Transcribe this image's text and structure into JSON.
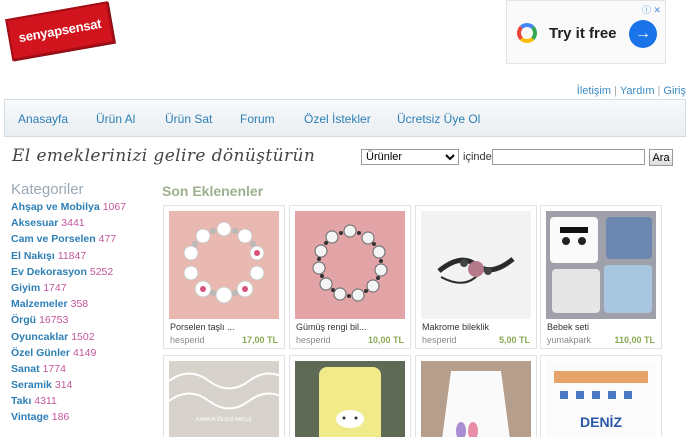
{
  "logo": {
    "text": "senyapsensat"
  },
  "ad": {
    "cta": "Try it free",
    "arrow": "→",
    "icons": "ⓘ ✕"
  },
  "toplinks": {
    "contact": "İletişim",
    "help": "Yardım",
    "login": "Giriş"
  },
  "nav": [
    "Anasayfa",
    "Ürün Al",
    "Ürün Sat",
    "Forum",
    "Özel İstekler",
    "Ücretsiz Üye Ol"
  ],
  "slogan": "El emeklerinizi gelire dönüştürün",
  "search": {
    "category": "Ürünler",
    "in_label": "içinde",
    "query": "",
    "button": "Ara"
  },
  "categories": {
    "title": "Kategoriler",
    "items": [
      {
        "name": "Ahşap ve Mobilya",
        "count": "1067"
      },
      {
        "name": "Aksesuar",
        "count": "3441"
      },
      {
        "name": "Cam ve Porselen",
        "count": "477"
      },
      {
        "name": "El Nakışı",
        "count": "11847"
      },
      {
        "name": "Ev Dekorasyon",
        "count": "5252"
      },
      {
        "name": "Giyim",
        "count": "1747"
      },
      {
        "name": "Malzemeler",
        "count": "358"
      },
      {
        "name": "Örgü",
        "count": "16753"
      },
      {
        "name": "Oyuncaklar",
        "count": "1502"
      },
      {
        "name": "Özel Günler",
        "count": "4149"
      },
      {
        "name": "Sanat",
        "count": "1774"
      },
      {
        "name": "Seramik",
        "count": "314"
      },
      {
        "name": "Takı",
        "count": "4311"
      },
      {
        "name": "Vintage",
        "count": "186"
      }
    ]
  },
  "new_items": {
    "title": "Son Eklenenler",
    "products": [
      {
        "title": "Porselen taşlı ...",
        "user": "hesperid",
        "price": "17,00 TL"
      },
      {
        "title": "Gümüş rengi bil...",
        "user": "hesperid",
        "price": "10,00 TL"
      },
      {
        "title": "Makrome bileklik",
        "user": "hesperid",
        "price": "5,00 TL"
      },
      {
        "title": "Bebek seti",
        "user": "yumakpark",
        "price": "110,00 TL"
      }
    ],
    "row2_texts": {
      "doily_caption": "KANAVA İĞLENİ HATILE",
      "pillow_text": "DENİZ"
    }
  },
  "colors": {
    "logo_red": "#d2141e",
    "link_blue": "#2e7fb6",
    "count_pink": "#c2569a",
    "price_green": "#8aaa55"
  }
}
